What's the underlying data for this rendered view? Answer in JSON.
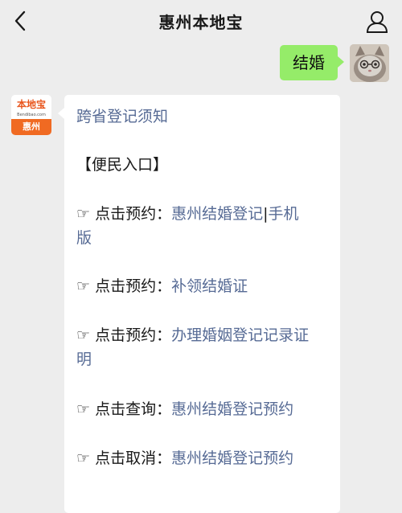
{
  "header": {
    "title": "惠州本地宝",
    "back_icon": "chevron-left-icon",
    "profile_icon": "person-icon"
  },
  "outgoing": {
    "text": "结婚",
    "bubble_color": "#95ec69"
  },
  "incoming": {
    "avatar": {
      "logo_text": "本地宝",
      "logo_sub": "Bendibao.com",
      "city": "惠州",
      "accent": "#f06a22"
    },
    "heading": "跨省登记须知",
    "section": "【便民入口】",
    "entries": [
      {
        "prefix": "☞ 点击预约：",
        "link": "惠州结婚登记",
        "sep": "|",
        "link2": "手机",
        "link3": "版"
      },
      {
        "prefix": "☞ 点击预约：",
        "link": "补领结婚证"
      },
      {
        "prefix": "☞ 点击预约：",
        "link": "办理婚姻登记记录证",
        "link2": "明"
      },
      {
        "prefix": "☞ 点击查询：",
        "link": "惠州结婚登记预约"
      },
      {
        "prefix": "☞ 点击取消：",
        "link": "惠州结婚登记预约"
      }
    ],
    "link_color": "#576b95"
  }
}
